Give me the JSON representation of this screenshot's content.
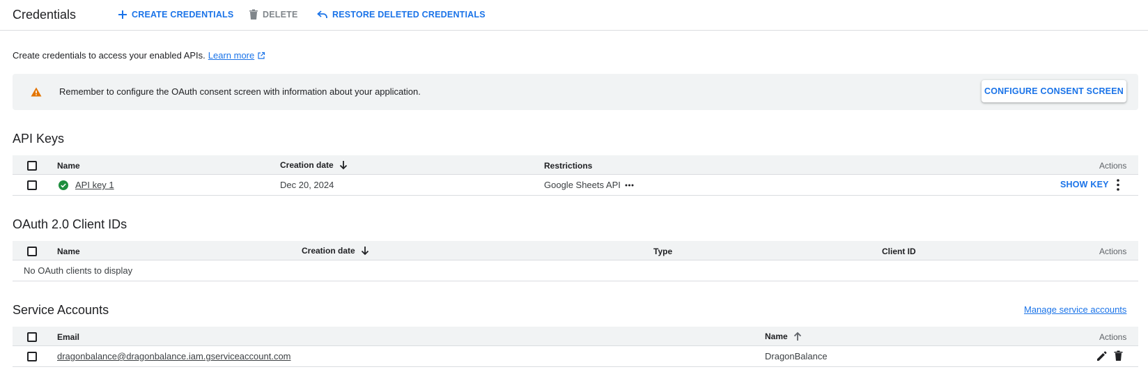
{
  "header": {
    "title": "Credentials",
    "create_label": "CREATE CREDENTIALS",
    "delete_label": "DELETE",
    "restore_label": "RESTORE DELETED CREDENTIALS"
  },
  "intro": {
    "text": "Create credentials to access your enabled APIs.",
    "learn_more": "Learn more"
  },
  "banner": {
    "message": "Remember to configure the OAuth consent screen with information about your application.",
    "button_label": "CONFIGURE CONSENT SCREEN"
  },
  "api_keys": {
    "title": "API Keys",
    "columns": {
      "name": "Name",
      "creation_date": "Creation date",
      "restrictions": "Restrictions",
      "actions": "Actions"
    },
    "rows": [
      {
        "name": "API key 1",
        "creation_date": "Dec 20, 2024",
        "restrictions": "Google Sheets API",
        "show_key": "SHOW KEY"
      }
    ]
  },
  "oauth": {
    "title": "OAuth 2.0 Client IDs",
    "columns": {
      "name": "Name",
      "creation_date": "Creation date",
      "type": "Type",
      "client_id": "Client ID",
      "actions": "Actions"
    },
    "empty_text": "No OAuth clients to display"
  },
  "service_accounts": {
    "title": "Service Accounts",
    "manage_link": "Manage service accounts",
    "columns": {
      "email": "Email",
      "name": "Name",
      "actions": "Actions"
    },
    "rows": [
      {
        "email": "dragonbalance@dragonbalance.iam.gserviceaccount.com",
        "name": "DragonBalance"
      }
    ]
  },
  "icons": {
    "create": "plus-icon",
    "delete": "trash-icon",
    "restore": "undo-icon",
    "external": "external-link-icon",
    "warning": "warning-icon",
    "status": "check-circle-icon",
    "more_h": "more-horizontal-icon",
    "more_v": "more-vertical-icon",
    "sort_down": "arrow-down-icon",
    "sort_up": "arrow-up-icon",
    "edit": "pencil-icon"
  },
  "colors": {
    "accent": "#1a73e8",
    "visited_link": "#681da8",
    "warning": "#e37400",
    "success": "#1e8e3e",
    "header_bg": "#f1f3f4",
    "border": "#dadce0"
  }
}
